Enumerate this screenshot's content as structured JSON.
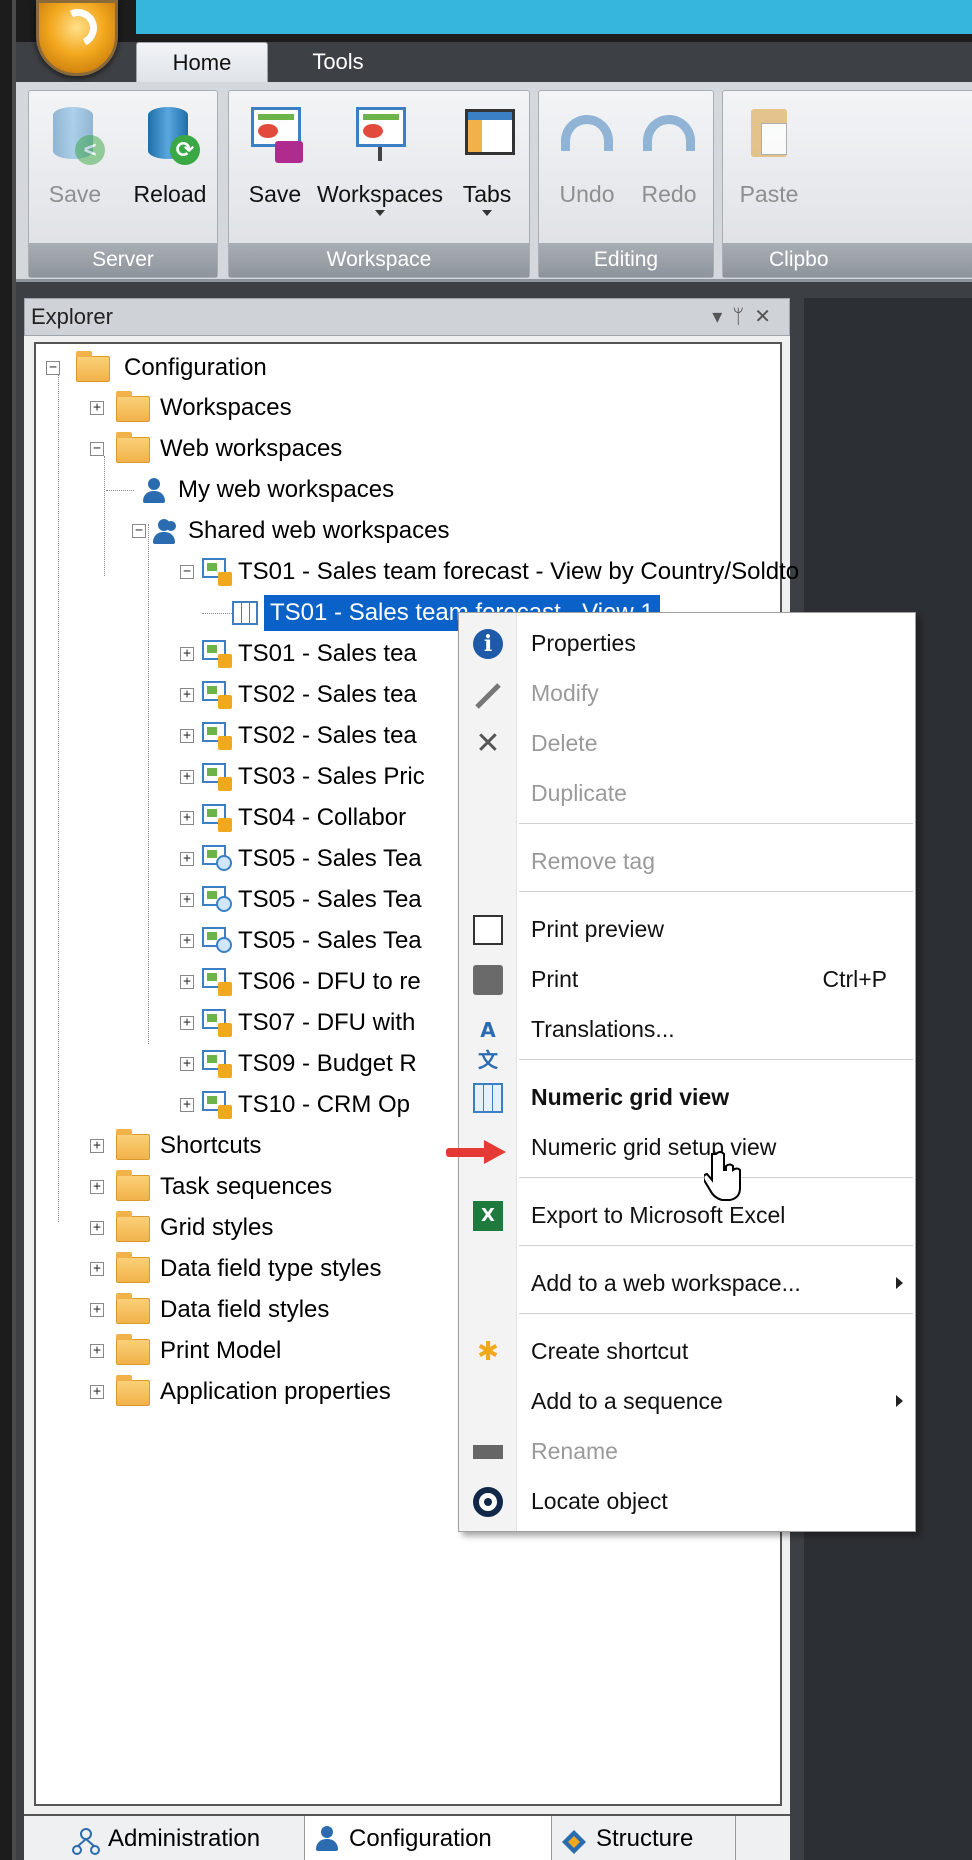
{
  "ribbon": {
    "tabs": [
      {
        "label": "Home",
        "active": true
      },
      {
        "label": "Tools",
        "active": false
      }
    ],
    "groups": {
      "server": {
        "label": "Server",
        "buttons": [
          "Save",
          "Reload"
        ]
      },
      "workspace": {
        "label": "Workspace",
        "buttons": [
          "Save",
          "Workspaces",
          "Tabs"
        ]
      },
      "editing": {
        "label": "Editing",
        "buttons": [
          "Undo",
          "Redo"
        ]
      },
      "clipboard": {
        "label": "Clipbo",
        "buttons": [
          "Paste"
        ]
      }
    }
  },
  "explorer": {
    "title": "Explorer",
    "header_buttons": [
      "▾",
      "ᛘ",
      "✕"
    ],
    "tree": {
      "root": "Configuration",
      "workspaces": "Workspaces",
      "web_workspaces": "Web workspaces",
      "my_web_workspaces": "My web workspaces",
      "shared_web_workspaces": "Shared web workspaces",
      "ts01_forecast": "TS01 - Sales team forecast - View by Country/Soldto",
      "selected_view": "TS01 - Sales team forecast - View 1",
      "items": [
        "TS01 - Sales tea",
        "TS02 - Sales tea",
        "TS02 - Sales tea",
        "TS03 - Sales Pric",
        "TS04 - Collabor",
        "TS05 - Sales Tea",
        "TS05 - Sales Tea",
        "TS05 - Sales Tea",
        "TS06 - DFU to re",
        "TS07 - DFU with",
        "TS09 - Budget R",
        "TS10 - CRM Op"
      ],
      "folders": [
        "Shortcuts",
        "Task sequences",
        "Grid styles",
        "Data field type styles",
        "Data field styles",
        "Print Model",
        "Application properties"
      ]
    }
  },
  "context_menu": {
    "items": {
      "properties": "Properties",
      "modify": "Modify",
      "delete": "Delete",
      "duplicate": "Duplicate",
      "remove_tag": "Remove tag",
      "print_preview": "Print preview",
      "print": "Print",
      "print_shortcut": "Ctrl+P",
      "translations": "Translations...",
      "numeric_grid_view": "Numeric grid view",
      "numeric_grid_setup_view": "Numeric grid setup view",
      "export_excel": "Export to Microsoft Excel",
      "add_web_workspace": "Add to a web workspace...",
      "create_shortcut": "Create shortcut",
      "add_sequence": "Add to a sequence",
      "rename": "Rename",
      "locate_object": "Locate object"
    }
  },
  "bottom_tabs": [
    "Administration",
    "Configuration",
    "Structure"
  ],
  "colors": {
    "title_bar": "#37b6dc",
    "selection": "#0a62c9",
    "arrow": "#e53935"
  }
}
